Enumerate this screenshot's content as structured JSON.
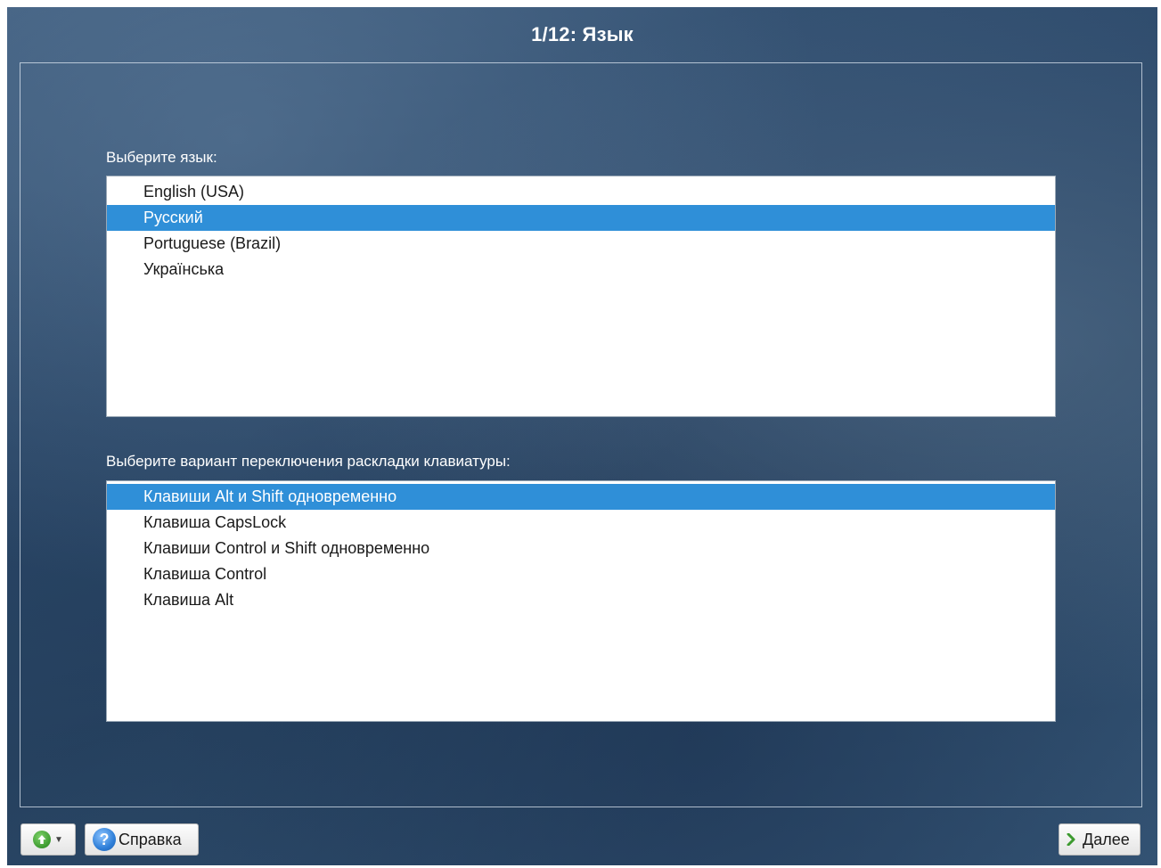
{
  "header": {
    "title": "1/12: Язык"
  },
  "language": {
    "label": "Выберите язык:",
    "items": [
      {
        "label": "English (USA)",
        "selected": false
      },
      {
        "label": "Русский",
        "selected": true
      },
      {
        "label": "Portuguese (Brazil)",
        "selected": false
      },
      {
        "label": "Українська",
        "selected": false
      }
    ]
  },
  "keyboard": {
    "label": "Выберите вариант переключения раскладки клавиатуры:",
    "items": [
      {
        "label": "Клавиши Alt и Shift одновременно",
        "selected": true
      },
      {
        "label": "Клавиша CapsLock",
        "selected": false
      },
      {
        "label": "Клавиши Control и Shift одновременно",
        "selected": false
      },
      {
        "label": "Клавиша Control",
        "selected": false
      },
      {
        "label": "Клавиша Alt",
        "selected": false
      }
    ]
  },
  "footer": {
    "help_label": "Справка",
    "next_label": "Далее"
  },
  "colors": {
    "selection": "#2f8fd8",
    "background": "#2e4b6c"
  }
}
